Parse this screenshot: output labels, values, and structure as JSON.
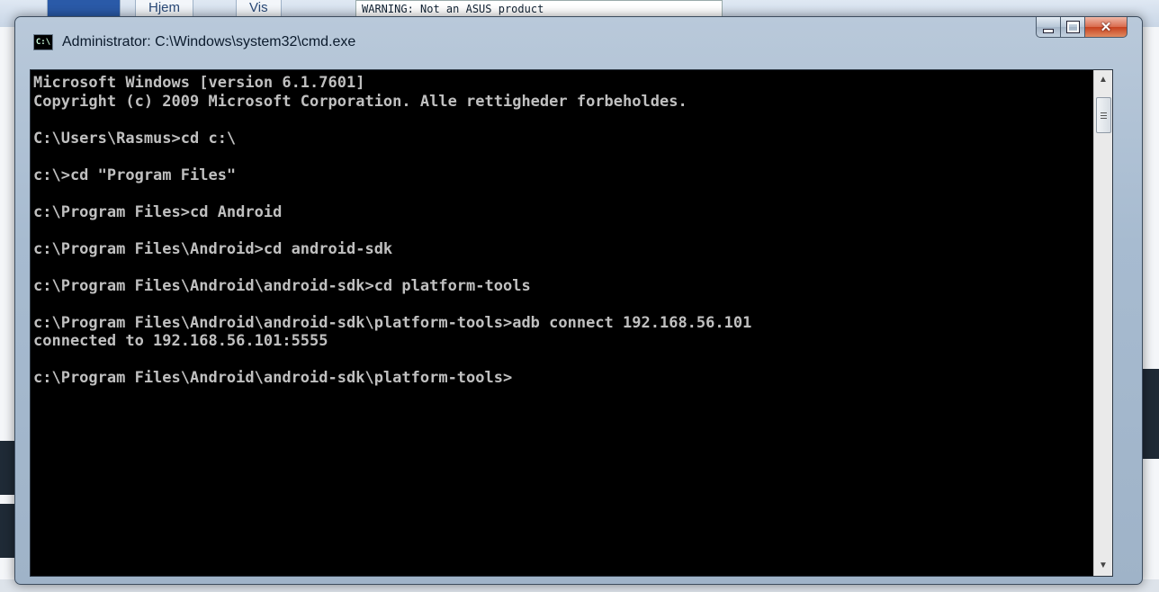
{
  "background": {
    "ribbon_tabs": [
      "Hjem",
      "Vis"
    ],
    "warning_text": "WARNING: Not an ASUS product"
  },
  "window": {
    "title": "Administrator: C:\\Windows\\system32\\cmd.exe",
    "icon": "cmd-icon",
    "controls": {
      "minimize": "minimize-icon",
      "maximize": "maximize-icon",
      "close": "close-icon"
    }
  },
  "console": {
    "lines": [
      "Microsoft Windows [version 6.1.7601]",
      "Copyright (c) 2009 Microsoft Corporation. Alle rettigheder forbeholdes.",
      "",
      "C:\\Users\\Rasmus>cd c:\\",
      "",
      "c:\\>cd \"Program Files\"",
      "",
      "c:\\Program Files>cd Android",
      "",
      "c:\\Program Files\\Android>cd android-sdk",
      "",
      "c:\\Program Files\\Android\\android-sdk>cd platform-tools",
      "",
      "c:\\Program Files\\Android\\android-sdk\\platform-tools>adb connect 192.168.56.101",
      "connected to 192.168.56.101:5555",
      "",
      "c:\\Program Files\\Android\\android-sdk\\platform-tools>"
    ]
  },
  "colors": {
    "console_bg": "#000000",
    "console_fg": "#c0c0c0"
  }
}
